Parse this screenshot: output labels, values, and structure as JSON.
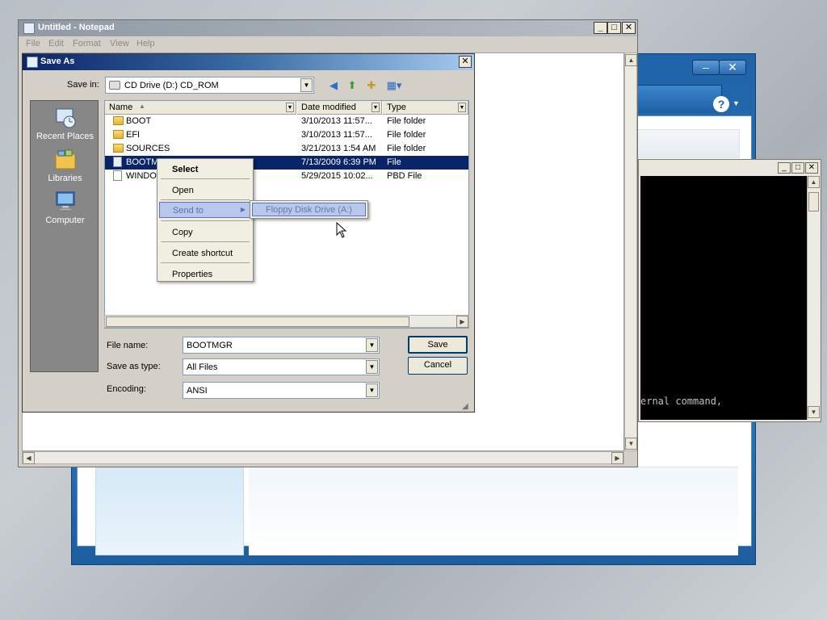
{
  "notepad": {
    "title": "Untitled - Notepad",
    "menu": [
      "File",
      "Edit",
      "Format",
      "View",
      "Help"
    ],
    "buttons": {
      "minimize": "_",
      "maximize": "□",
      "close": "✕"
    }
  },
  "console": {
    "visible_text": "ernal command,"
  },
  "setup": {
    "help_icon": "?"
  },
  "save_as": {
    "title": "Save As",
    "save_in_label": "Save in:",
    "save_in_value": "CD Drive (D:) CD_ROM",
    "places": [
      {
        "label": "Recent Places",
        "icon": "recent-places-icon"
      },
      {
        "label": "Libraries",
        "icon": "libraries-icon"
      },
      {
        "label": "Computer",
        "icon": "computer-icon"
      }
    ],
    "columns": [
      "Name",
      "Date modified",
      "Type"
    ],
    "files": [
      {
        "name": "BOOT",
        "date": "3/10/2013 11:57...",
        "type": "File folder",
        "kind": "folder"
      },
      {
        "name": "EFI",
        "date": "3/10/2013 11:57...",
        "type": "File folder",
        "kind": "folder"
      },
      {
        "name": "SOURCES",
        "date": "3/21/2013 1:54 AM",
        "type": "File folder",
        "kind": "folder"
      },
      {
        "name": "BOOTMGR",
        "date": "7/13/2009 6:39 PM",
        "type": "File",
        "kind": "file",
        "selected": true
      },
      {
        "name": "WINDOWS",
        "date": "5/29/2015 10:02...",
        "type": "PBD File",
        "kind": "doc"
      }
    ],
    "file_name_label": "File name:",
    "file_name_value": "BOOTMGR",
    "save_type_label": "Save as type:",
    "save_type_value": "All Files",
    "encoding_label": "Encoding:",
    "encoding_value": "ANSI",
    "save_button": "Save",
    "cancel_button": "Cancel"
  },
  "context_menu": {
    "items": [
      "Select",
      "Open",
      "Send to",
      "Copy",
      "Create shortcut",
      "Properties"
    ],
    "submenu": "Floppy Disk Drive (A:)"
  }
}
